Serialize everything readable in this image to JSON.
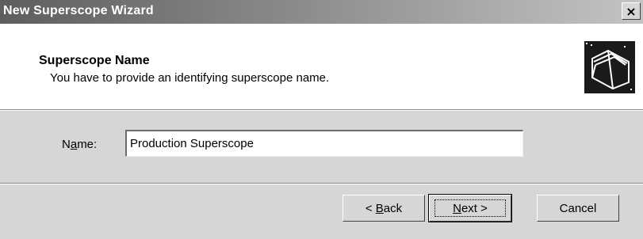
{
  "window": {
    "title": "New Superscope Wizard",
    "close_label": "×"
  },
  "header": {
    "title": "Superscope Name",
    "subtitle": "You have to provide an identifying superscope name.",
    "icon": "folder-wizard-icon"
  },
  "form": {
    "name_label_pre": "N",
    "name_label_mnemonic": "a",
    "name_label_post": "me:",
    "name_value": "Production Superscope"
  },
  "buttons": {
    "back_pre": "< ",
    "back_mnemonic": "B",
    "back_post": "ack",
    "next_mnemonic": "N",
    "next_post": "ext >",
    "cancel_label": "Cancel"
  },
  "colors": {
    "title_bar": "#5e5e5e",
    "dialog_bg": "#d6d6d6",
    "header_bg": "#ffffff"
  }
}
